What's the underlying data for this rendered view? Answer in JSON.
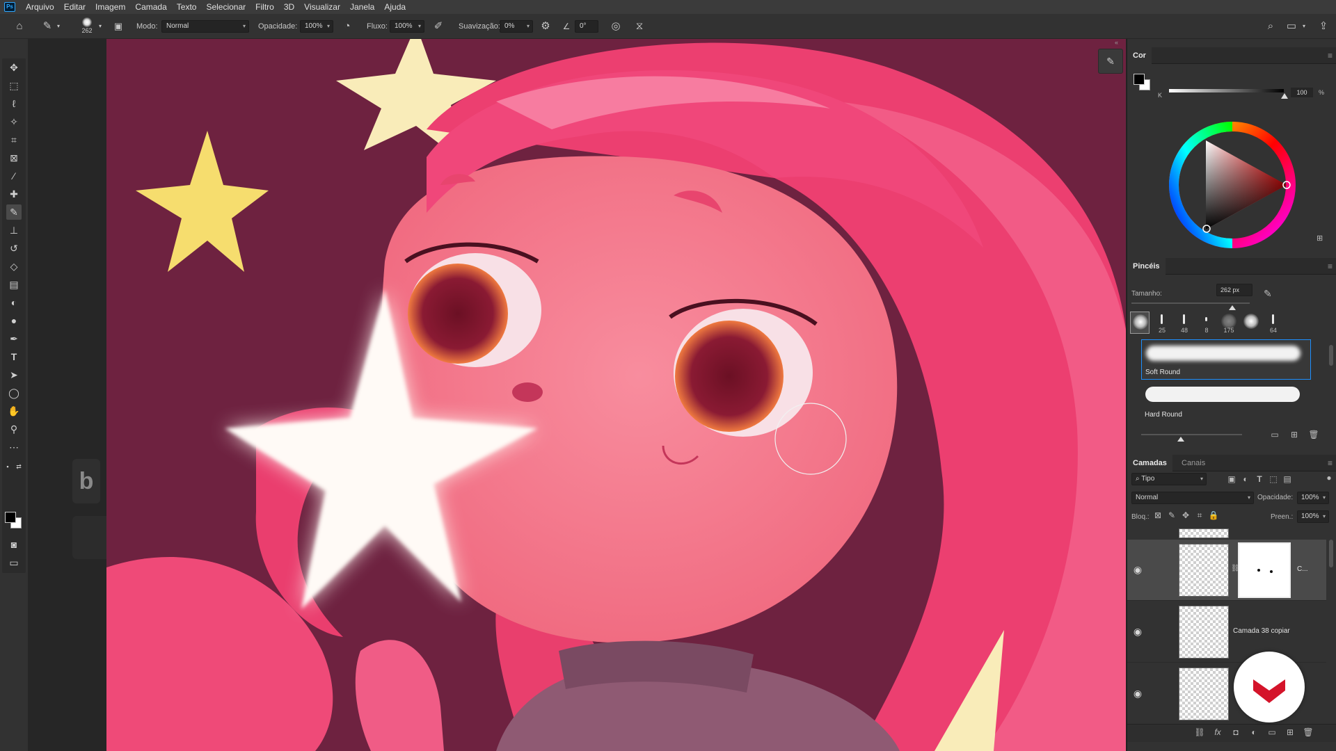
{
  "app": {
    "logo": "Ps"
  },
  "menu": [
    "Arquivo",
    "Editar",
    "Imagem",
    "Camada",
    "Texto",
    "Selecionar",
    "Filtro",
    "3D",
    "Visualizar",
    "Janela",
    "Ajuda"
  ],
  "options": {
    "brush_size": "262",
    "mode_label": "Modo:",
    "mode_value": "Normal",
    "opacity_label": "Opacidade:",
    "opacity_value": "100%",
    "flow_label": "Fluxo:",
    "flow_value": "100%",
    "smoothing_label": "Suavização:",
    "smoothing_value": "0%",
    "angle_value": "0°"
  },
  "toolbar": {
    "tools": [
      "move-tool",
      "marquee-tool",
      "lasso-tool",
      "magic-wand-tool",
      "crop-tool",
      "frame-tool",
      "eyedropper-tool",
      "healing-tool",
      "brush-tool",
      "stamp-tool",
      "history-brush-tool",
      "eraser-tool",
      "gradient-tool",
      "blur-tool",
      "dodge-tool",
      "pen-tool",
      "type-tool",
      "path-selection-tool",
      "ellipse-tool",
      "hand-tool",
      "zoom-tool",
      "more-tools"
    ],
    "active_tool": "brush-tool",
    "foreground_color": "#000000",
    "background_color": "#ffffff"
  },
  "key_overlay": "b",
  "color_panel": {
    "title": "Cor",
    "k_label": "K",
    "k_value": "100",
    "k_unit": "%"
  },
  "brushes_panel": {
    "title": "Pincéis",
    "size_label": "Tamanho:",
    "size_value": "262 px",
    "size_level": 0.85,
    "tips": [
      "",
      "25",
      "48",
      "8",
      "175",
      "",
      "64"
    ],
    "presets": [
      {
        "name": "Soft Round",
        "selected": true
      },
      {
        "name": "Hard Round",
        "selected": false
      }
    ]
  },
  "layers_panel": {
    "tabs": [
      "Camadas",
      "Canais"
    ],
    "filter_value": "Tipo",
    "blend_mode": "Normal",
    "opacity_label": "Opacidade:",
    "opacity_value": "100%",
    "lock_label": "Bloq.:",
    "fill_label": "Preen.:",
    "fill_value": "100%",
    "layers": [
      {
        "name": "C...",
        "visible": true,
        "selected": true,
        "has_mask": true
      },
      {
        "name": "Camada 38 copiar",
        "visible": true,
        "selected": false,
        "has_mask": false
      },
      {
        "name": "",
        "visible": true,
        "selected": false,
        "has_mask": false
      }
    ]
  },
  "colors": {
    "canvas_bg": "#6e2240",
    "hair": "#f2487b",
    "skin": "#f7879b",
    "star_yellow": "#f6dd6e",
    "selection_blue": "#1e90ff",
    "logo_red": "#d4142a"
  }
}
